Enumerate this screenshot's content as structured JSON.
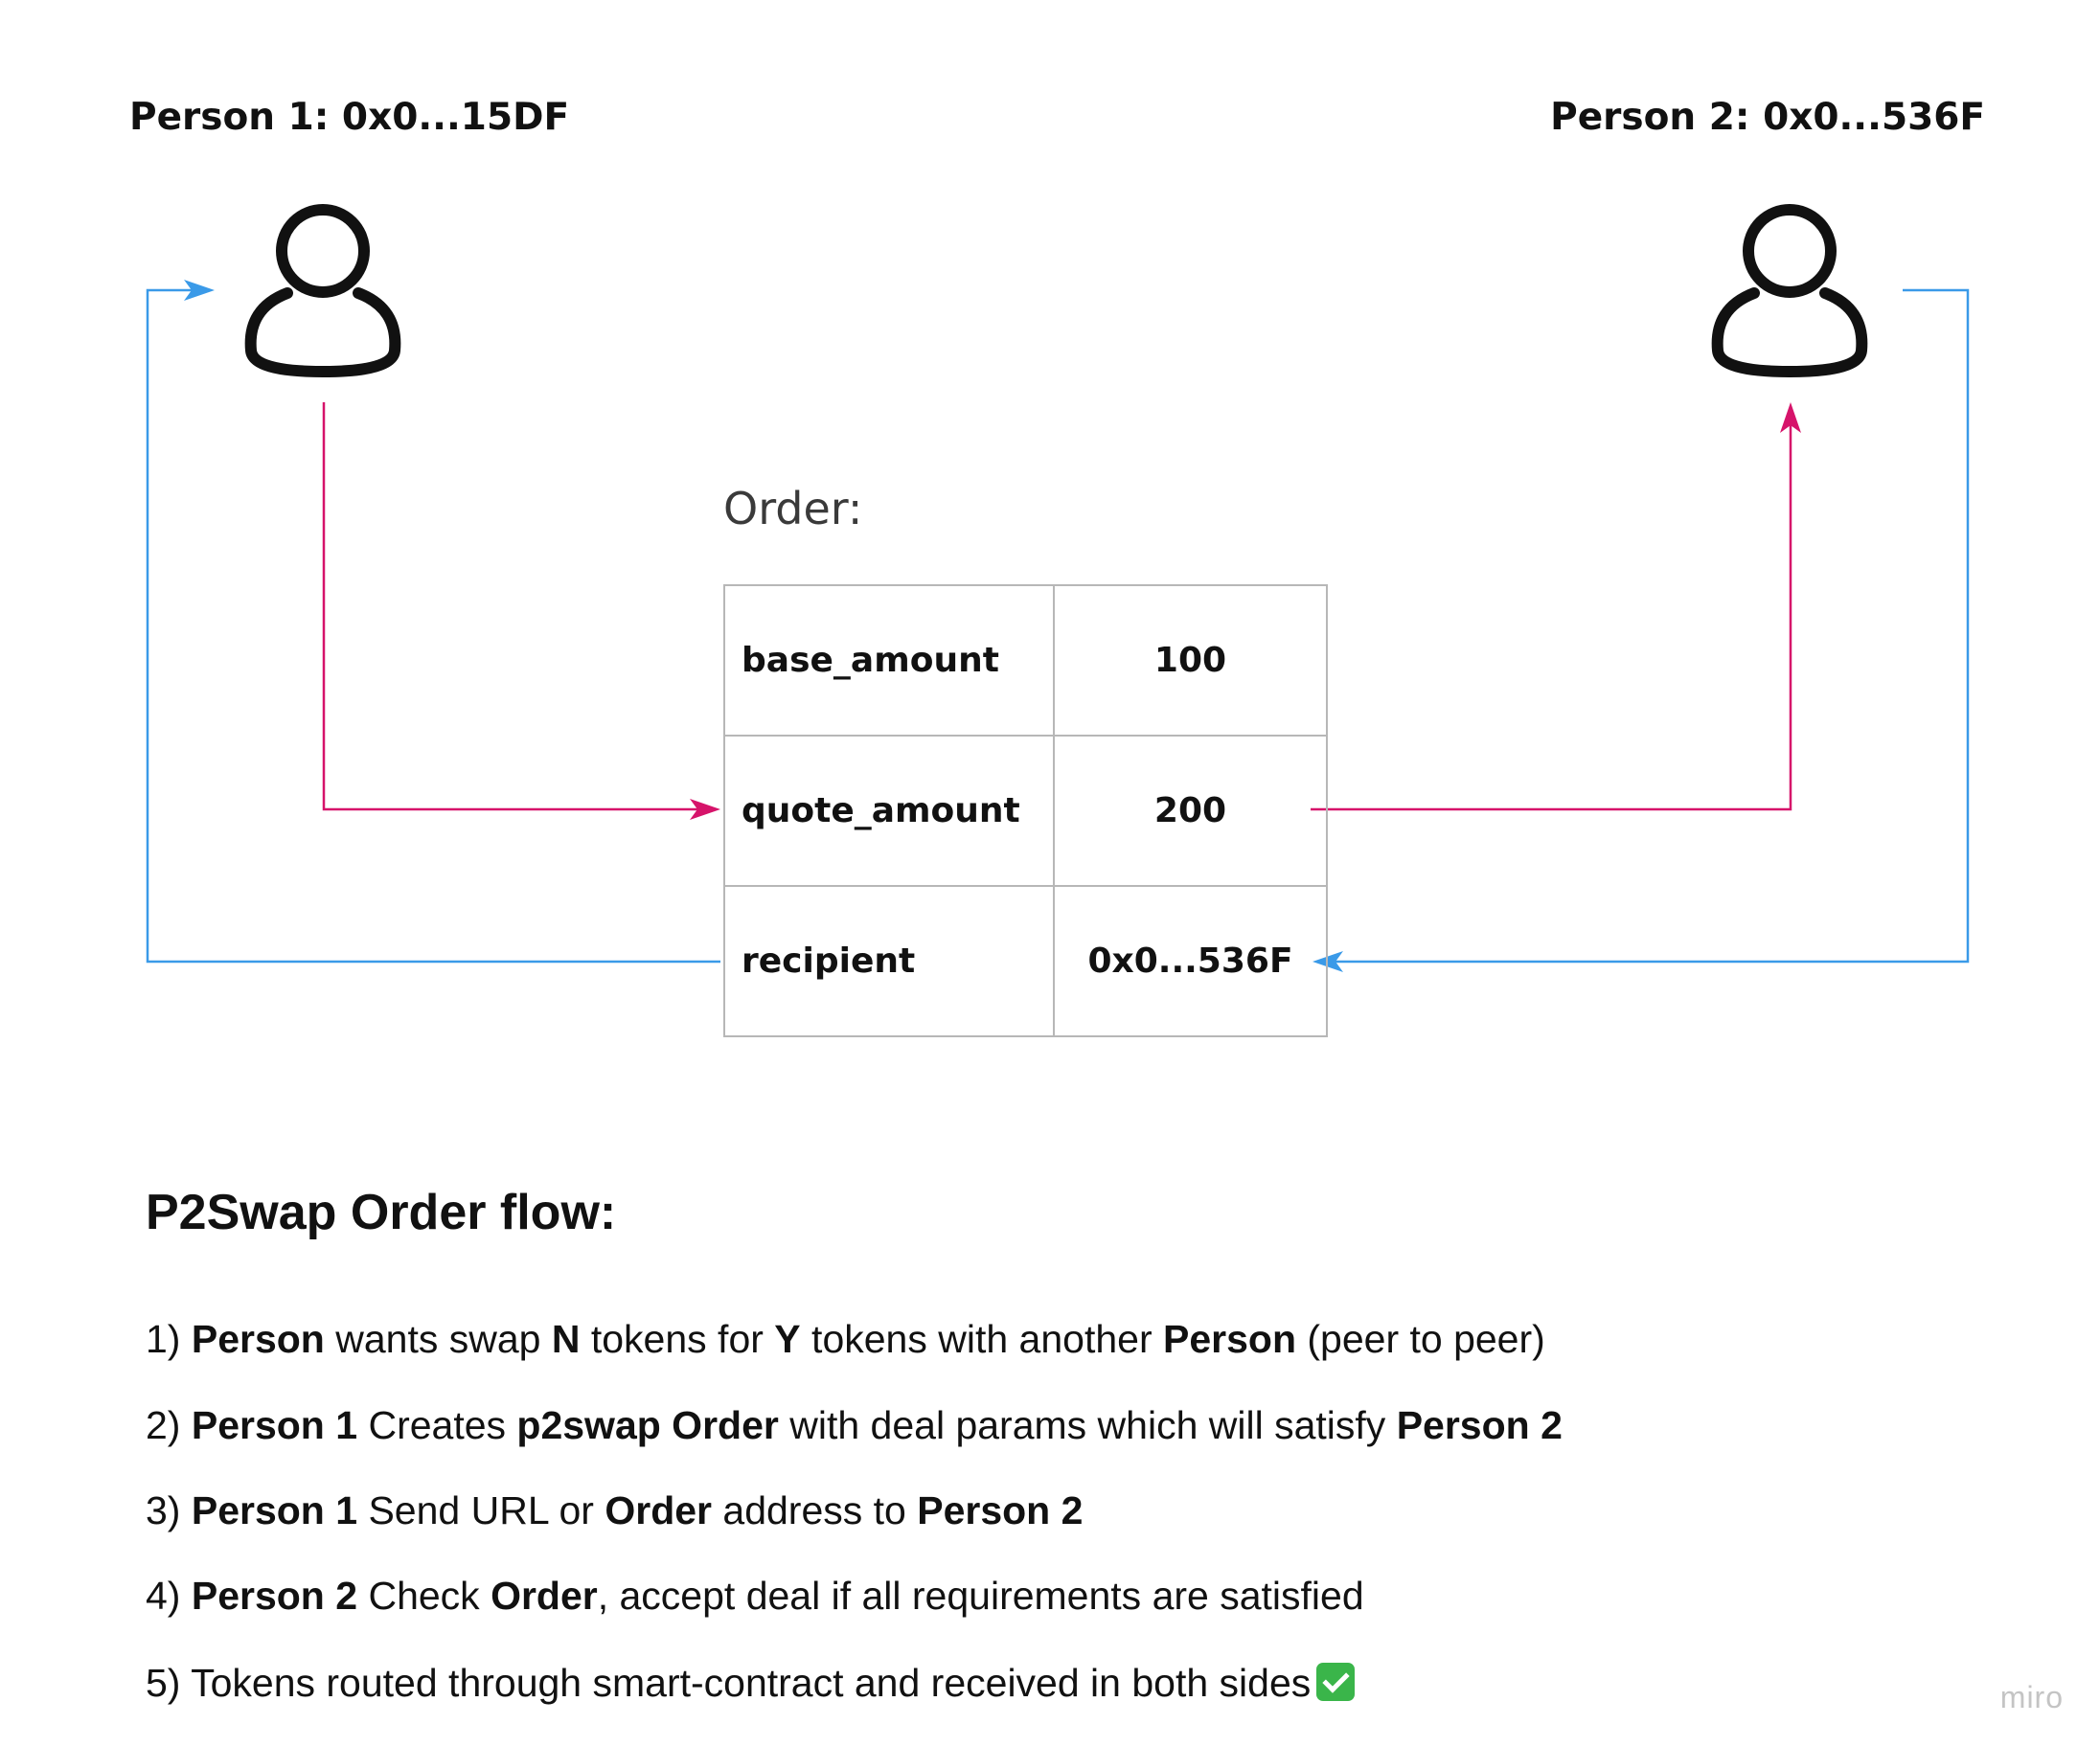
{
  "person1": {
    "label": "Person 1: 0x0...15DF",
    "icon": "user-icon"
  },
  "person2": {
    "label": "Person 2: 0x0...536F",
    "icon": "user-icon"
  },
  "order": {
    "title": "Order:",
    "rows": [
      {
        "key": "base_amount",
        "value": "100"
      },
      {
        "key": "quote_amount",
        "value": "200"
      },
      {
        "key": "recipient",
        "value": "0x0...536F"
      }
    ]
  },
  "flow": {
    "title": "P2Swap Order flow:",
    "steps": [
      [
        {
          "t": "1) "
        },
        {
          "t": "Person",
          "b": true
        },
        {
          "t": " wants swap "
        },
        {
          "t": "N",
          "b": true
        },
        {
          "t": " tokens for "
        },
        {
          "t": "Y",
          "b": true
        },
        {
          "t": " tokens with another "
        },
        {
          "t": "Person",
          "b": true
        },
        {
          "t": " (peer to peer)"
        }
      ],
      [
        {
          "t": "2) "
        },
        {
          "t": "Person 1",
          "b": true
        },
        {
          "t": " Creates "
        },
        {
          "t": "p2swap Order",
          "b": true
        },
        {
          "t": " with deal params which will satisfy "
        },
        {
          "t": "Person 2",
          "b": true
        }
      ],
      [
        {
          "t": "3) "
        },
        {
          "t": "Person 1",
          "b": true
        },
        {
          "t": " Send URL or "
        },
        {
          "t": "Order",
          "b": true
        },
        {
          "t": " address to "
        },
        {
          "t": "Person 2",
          "b": true
        }
      ],
      [
        {
          "t": "4) "
        },
        {
          "t": "Person 2",
          "b": true
        },
        {
          "t": " Check "
        },
        {
          "t": "Order",
          "b": true
        },
        {
          "t": ", accept deal if all requirements are satisfied"
        }
      ],
      [
        {
          "t": "5) Tokens routed through smart-contract and received in both sides"
        },
        {
          "t": "",
          "check": true
        }
      ]
    ]
  },
  "colors": {
    "magenta": "#d6136a",
    "blue": "#3a9ae8"
  },
  "watermark": "miro"
}
